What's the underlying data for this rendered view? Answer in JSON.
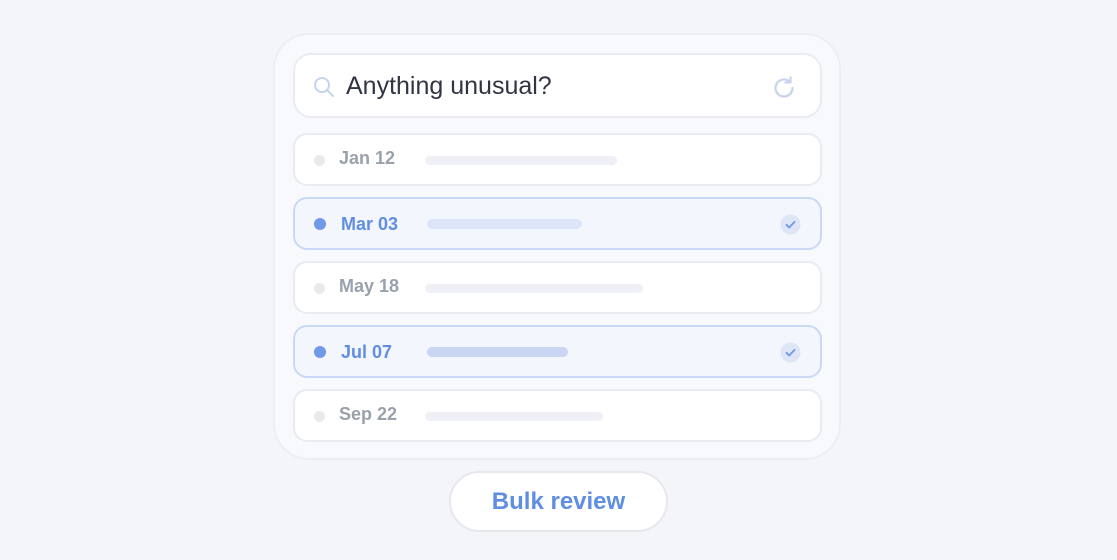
{
  "search": {
    "query": "Anything unusual?",
    "search_icon": "search-icon",
    "refresh_icon": "refresh-icon"
  },
  "rows": [
    {
      "date": "Jan 12",
      "selected": false,
      "bar_fraction": 0.52
    },
    {
      "date": "Mar 03",
      "selected": true,
      "bar_fraction": 0.42
    },
    {
      "date": "May 18",
      "selected": false,
      "bar_fraction": 0.59
    },
    {
      "date": "Jul 07",
      "selected": true,
      "bar_fraction": 0.38
    },
    {
      "date": "Sep 22",
      "selected": false,
      "bar_fraction": 0.48
    }
  ],
  "bulk_button": {
    "label": "Bulk review"
  },
  "colors": {
    "accent": "#5f8ee4",
    "selected_bg": "#f3f6fd",
    "selected_border": "#c9d8f5",
    "muted_text": "#9aa1ad",
    "bar_idle": "#eef0f5",
    "bar_selected_a": "#dde6f8",
    "bar_selected_b": "#c9d6f3"
  }
}
